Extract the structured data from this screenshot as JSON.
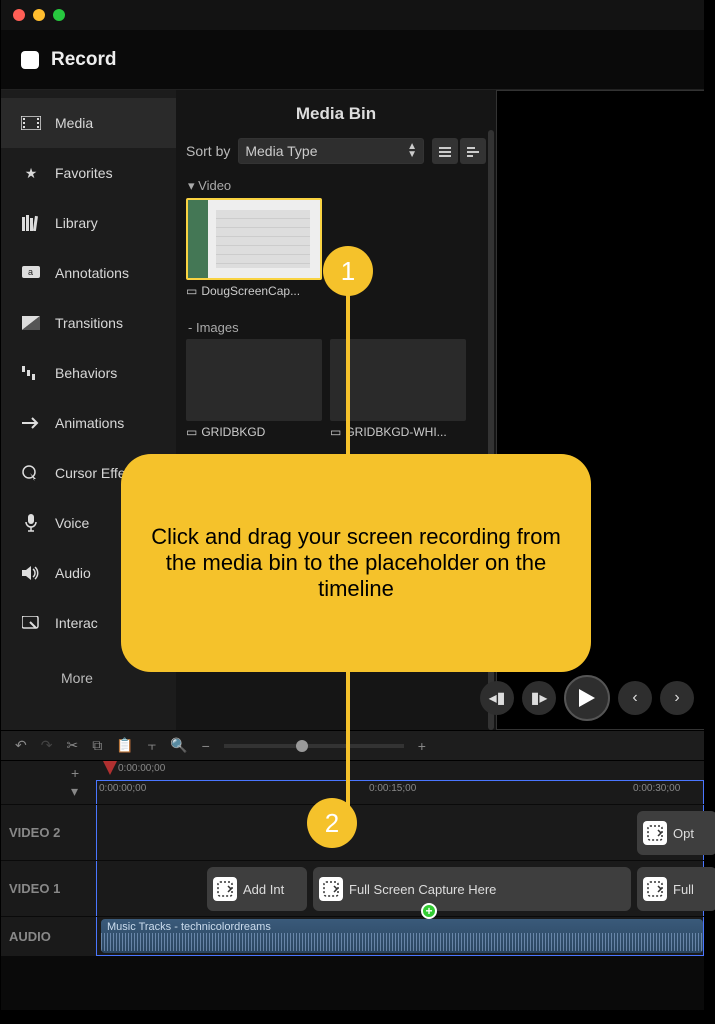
{
  "record_label": "Record",
  "sidebar": {
    "items": [
      {
        "label": "Media",
        "icon": "media"
      },
      {
        "label": "Favorites",
        "icon": "star"
      },
      {
        "label": "Library",
        "icon": "books"
      },
      {
        "label": "Annotations",
        "icon": "annotation"
      },
      {
        "label": "Transitions",
        "icon": "transition"
      },
      {
        "label": "Behaviors",
        "icon": "behaviors"
      },
      {
        "label": "Animations",
        "icon": "arrow"
      },
      {
        "label": "Cursor Effects",
        "icon": "cursor"
      },
      {
        "label": "Voice",
        "icon": "mic"
      },
      {
        "label": "Audio",
        "icon": "speaker"
      },
      {
        "label": "Interac",
        "icon": "interactivity"
      }
    ],
    "more_label": "More"
  },
  "media_bin": {
    "title": "Media Bin",
    "sort_label": "Sort by",
    "sort_value": "Media Type",
    "sections": {
      "video_header": "Video",
      "images_header": "Images"
    },
    "video_items": [
      {
        "label": "DougScreenCap..."
      }
    ],
    "image_items": [
      {
        "label": "GRIDBKGD"
      },
      {
        "label": "GRIDBKGD-WHI..."
      }
    ]
  },
  "timeline": {
    "ruler_top_tc": "0:00:00;00",
    "ticks": [
      "0:00:00;00",
      "0:00:15;00",
      "0:00:30;00"
    ],
    "tracks": {
      "video2": "VIDEO 2",
      "video1": "VIDEO 1",
      "audio": "AUDIO"
    },
    "clips": {
      "v2_opt": "Opt",
      "v1_addint": "Add Int",
      "v1_fullscreen": "Full Screen Capture Here",
      "v1_full": "Full",
      "audio_name": "Music Tracks - technicolordreams"
    }
  },
  "callout": {
    "text": "Click and drag your screen recording from the media bin to the placeholder on the timeline",
    "step1": "1",
    "step2": "2"
  }
}
